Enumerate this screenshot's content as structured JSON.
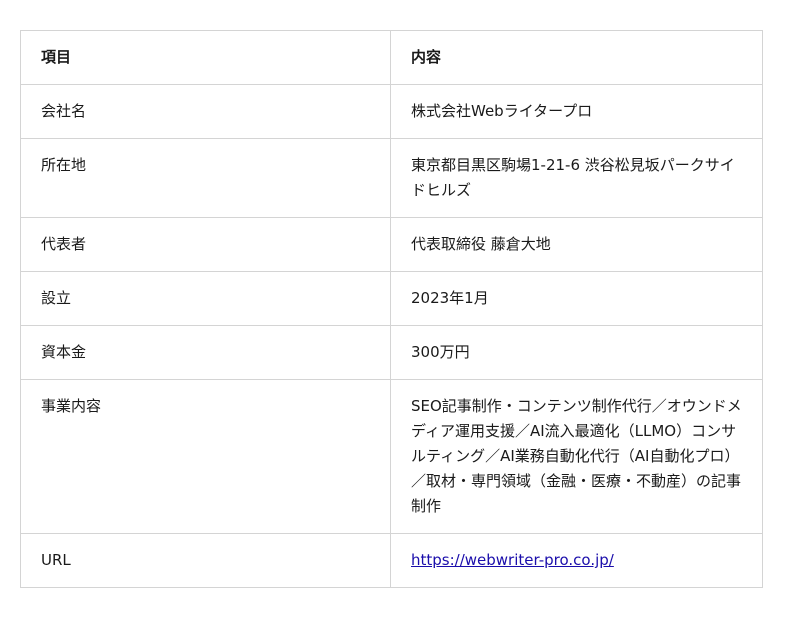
{
  "table": {
    "headers": [
      "項目",
      "内容"
    ],
    "rows": [
      {
        "label": "会社名",
        "value": "株式会社Webライタープロ"
      },
      {
        "label": "所在地",
        "value": "東京都目黒区駒場1-21-6 渋谷松見坂パークサイドヒルズ"
      },
      {
        "label": "代表者",
        "value": "代表取締役 藤倉大地"
      },
      {
        "label": "設立",
        "value": "2023年1月"
      },
      {
        "label": "資本金",
        "value": "300万円"
      },
      {
        "label": "事業内容",
        "value": "SEO記事制作・コンテンツ制作代行／オウンドメディア運用支援／AI流入最適化（LLMO）コンサルティング／AI業務自動化代行（AI自動化プロ）／取材・専門領域（金融・医療・不動産）の記事制作"
      },
      {
        "label": "URL",
        "value": "https://webwriter-pro.co.jp/"
      }
    ]
  },
  "colors": {
    "border": "#d4d4d4",
    "text": "#1a1a1a",
    "link": "#1a0dab"
  }
}
